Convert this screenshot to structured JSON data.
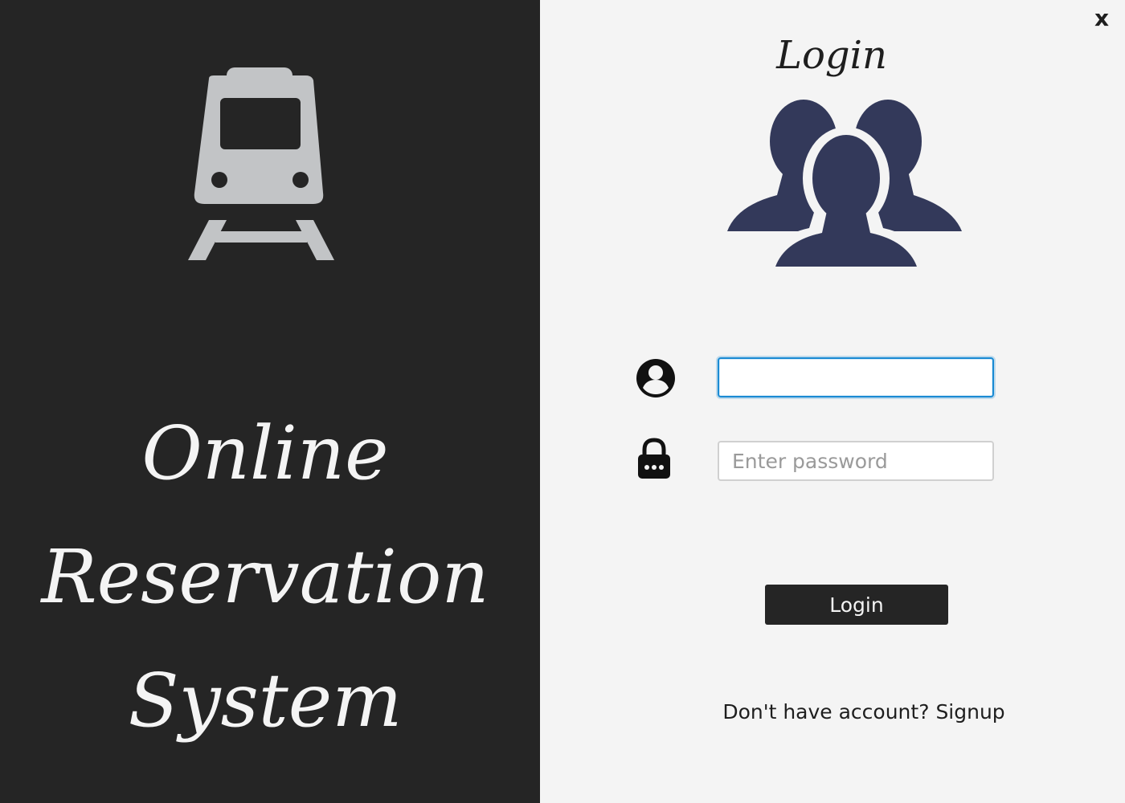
{
  "app": {
    "title_lines": [
      "Online",
      "Reservation",
      "System"
    ]
  },
  "window": {
    "close_label": "x"
  },
  "login_form": {
    "heading": "Login",
    "username": {
      "value": "",
      "placeholder": ""
    },
    "password": {
      "value": "",
      "placeholder": "Enter password"
    },
    "submit_label": "Login",
    "signup_prompt": "Don't have account? ",
    "signup_link": "Signup"
  },
  "icons": {
    "logo": "train-icon",
    "header": "users-group-icon",
    "username": "user-circle-icon",
    "password": "lock-icon"
  },
  "colors": {
    "left_panel_bg": "#252525",
    "right_panel_bg": "#f4f4f4",
    "logo_color": "#c2c4c6",
    "users_icon_color": "#33395a",
    "button_bg": "#252525",
    "focus_border": "#1a8ad3"
  }
}
